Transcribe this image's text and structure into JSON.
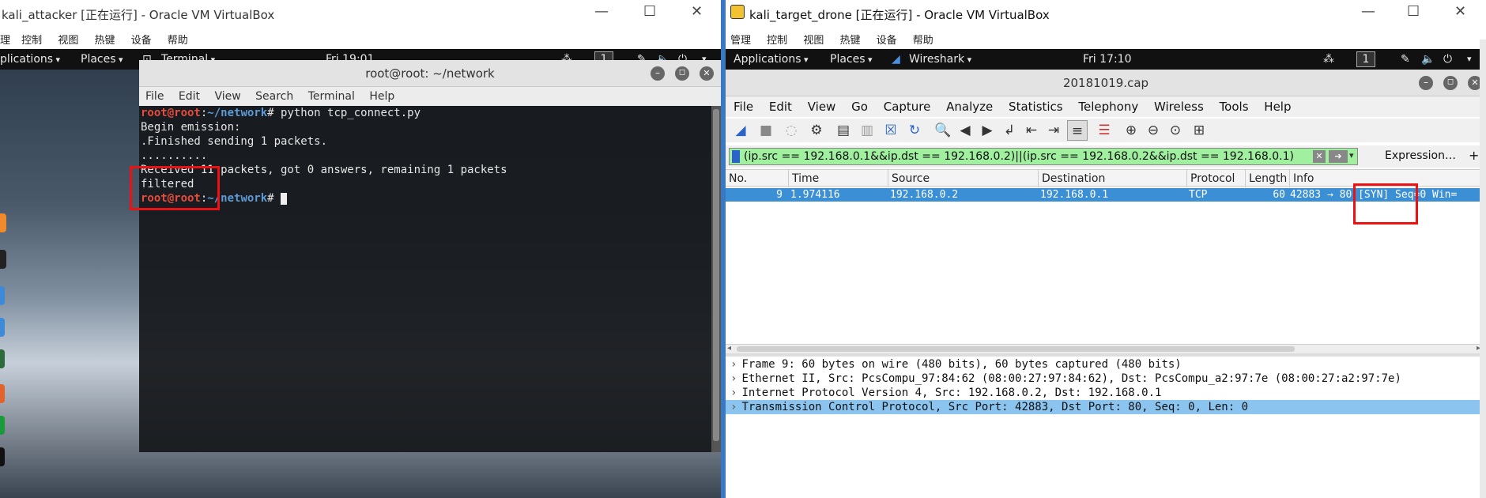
{
  "left_vm": {
    "title": "kali_attacker [正在运行] - Oracle VM VirtualBox",
    "menu": [
      "控制",
      "视图",
      "热键",
      "设备",
      "帮助"
    ],
    "menu_partial_first": "理",
    "gnome": {
      "applications": "plications",
      "places": "Places",
      "terminal": "Terminal",
      "clock": "Fri 19:01",
      "workspace": "1"
    },
    "terminal": {
      "title": "root@root: ~/network",
      "menu": [
        "File",
        "Edit",
        "View",
        "Search",
        "Terminal",
        "Help"
      ],
      "lines": [
        {
          "user": "root@root",
          "path": "~/network",
          "cmd": "python tcp_connect.py"
        },
        {
          "text": "Begin emission:"
        },
        {
          "text": ".Finished sending 1 packets."
        },
        {
          "text": ".........."
        },
        {
          "text": "Received 11 packets, got 0 answers, remaining 1 packets"
        },
        {
          "text": "filtered"
        },
        {
          "user": "root@root",
          "path": "~/network",
          "cmd": ""
        }
      ]
    }
  },
  "right_vm": {
    "title": "kali_target_drone [正在运行] - Oracle VM VirtualBox",
    "menu": [
      "管理",
      "控制",
      "视图",
      "热键",
      "设备",
      "帮助"
    ],
    "gnome": {
      "applications": "Applications",
      "places": "Places",
      "wireshark": "Wireshark",
      "clock": "Fri 17:10",
      "workspace": "1"
    },
    "wireshark": {
      "title": "20181019.cap",
      "menu": [
        "File",
        "Edit",
        "View",
        "Go",
        "Capture",
        "Analyze",
        "Statistics",
        "Telephony",
        "Wireless",
        "Tools",
        "Help"
      ],
      "filter": "(ip.src == 192.168.0.1&&ip.dst == 192.168.0.2)||(ip.src == 192.168.0.2&&ip.dst == 192.168.0.1)",
      "expression_label": "Expression…",
      "plus_label": "+",
      "columns": [
        "No.",
        "Time",
        "Source",
        "Destination",
        "Protocol",
        "Length",
        "Info"
      ],
      "packet": {
        "no": "9",
        "time": "1.974116",
        "source": "192.168.0.2",
        "destination": "192.168.0.1",
        "protocol": "TCP",
        "length": "60",
        "info": "42883 → 80 [SYN] Seq=0 Win="
      },
      "details": [
        "Frame 9: 60 bytes on wire (480 bits), 60 bytes captured (480 bits)",
        "Ethernet II, Src: PcsCompu_97:84:62 (08:00:27:97:84:62), Dst: PcsCompu_a2:97:7e (08:00:27:a2:97:7e)",
        "Internet Protocol Version 4, Src: 192.168.0.2, Dst: 192.168.0.1",
        "Transmission Control Protocol, Src Port: 42883, Dst Port: 80, Seq: 0, Len: 0"
      ]
    }
  },
  "colors": {
    "selected_row": "#3b8fd4",
    "highlight_detail": "#8cc4f0",
    "filter_bg": "#a0f0a0",
    "annotation": "#ee1111"
  }
}
